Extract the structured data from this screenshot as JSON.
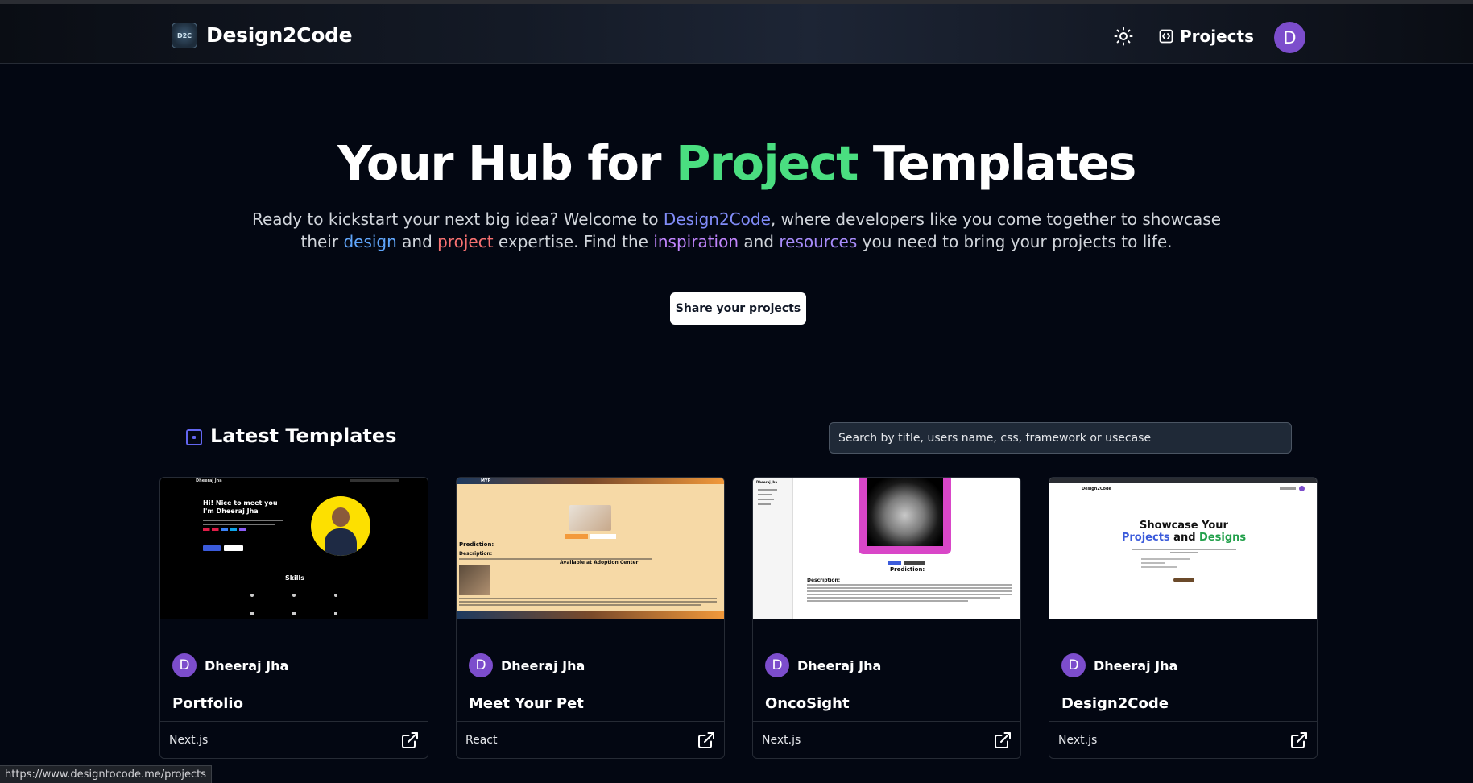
{
  "nav": {
    "logo_text": "D2C",
    "brand": "Design2Code",
    "projects_label": "Projects",
    "avatar_initial": "D"
  },
  "hero": {
    "title_part1": "Your Hub for ",
    "title_highlight": "Project",
    "title_part2": " Templates",
    "sub_1": "Ready to kickstart your next big idea? Welcome to ",
    "sub_brand": "Design2Code",
    "sub_2": ", where developers like you come together to showcase their ",
    "sub_design": "design",
    "sub_3": " and ",
    "sub_project": "project",
    "sub_4": " expertise. Find the ",
    "sub_inspiration": "inspiration",
    "sub_5": " and ",
    "sub_resources": "resources",
    "sub_6": " you need to bring your projects to life.",
    "share_button": "Share your projects"
  },
  "section": {
    "title": "Latest Templates",
    "search_placeholder": "Search by title, users name, css, framework or usecase"
  },
  "cards": [
    {
      "author": "Dheeraj Jha",
      "avatar_initial": "D",
      "title": "Portfolio",
      "framework": "Next.js"
    },
    {
      "author": "Dheeraj Jha",
      "avatar_initial": "D",
      "title": "Meet Your Pet",
      "framework": "React"
    },
    {
      "author": "Dheeraj Jha",
      "avatar_initial": "D",
      "title": "OncoSight",
      "framework": "Next.js"
    },
    {
      "author": "Dheeraj Jha",
      "avatar_initial": "D",
      "title": "Design2Code",
      "framework": "Next.js"
    }
  ],
  "thumbs": {
    "portfolio": {
      "name": "Dheeraj Jha",
      "headline": "Hi! Nice to meet you I'm Dheeraj Jha",
      "skills": "Skills"
    },
    "pet": {
      "brand": "MYP",
      "prediction": "Prediction:",
      "description": "Description:",
      "center": "Available at Adoption Center"
    },
    "onco": {
      "brand": "Dheeraj Jha",
      "prediction": "Prediction:",
      "description": "Description:"
    },
    "d2c": {
      "brand": "Design2Code",
      "line1": "Showcase Your",
      "projects": "Projects",
      "and": " and ",
      "designs": "Designs"
    }
  },
  "status_url": "https://www.designtocode.me/projects",
  "colors": {
    "background": "#030712",
    "accent_green": "#4ade80",
    "accent_indigo": "#818cf8",
    "avatar": "#7c4dcc"
  },
  "icons": {
    "theme": "sun-icon",
    "projects": "code-box-icon",
    "section": "square-dot-icon",
    "external": "external-link-icon"
  }
}
